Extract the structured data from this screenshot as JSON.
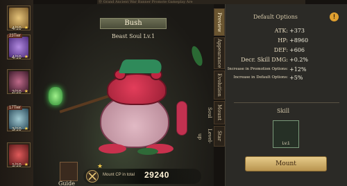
{
  "top_banner": "Ⓓ Grand Ancient War Banner Promote Gameplay Are",
  "roster": [
    {
      "level": "4/10",
      "tier": "",
      "color": "#d8b46a"
    },
    {
      "level": "4/10",
      "tier": "23Tier",
      "color": "#8a5acb"
    },
    {
      "level": "2/10",
      "tier": "",
      "color": "#8a3a5a"
    },
    {
      "level": "3/10",
      "tier": "17Tier",
      "color": "#5a8a9a"
    },
    {
      "level": "1/10",
      "tier": "",
      "color": "#c23a3a"
    }
  ],
  "pet": {
    "name": "Bush",
    "subtitle": "Beast Soul Lv.1"
  },
  "guide_label": "Guide",
  "power": {
    "label": "Mount CP in total",
    "value": "29240"
  },
  "tabs": [
    "Preview",
    "Appearance",
    "Evolution",
    "Mount Soul",
    "Star Level-up"
  ],
  "active_tab": 0,
  "options": {
    "title": "Default Options",
    "info_icon": "!",
    "stats": [
      {
        "key": "ATK:",
        "value": "+373"
      },
      {
        "key": "HP:",
        "value": "+8960"
      },
      {
        "key": "DEF:",
        "value": "+606"
      },
      {
        "key": "Decr. Skill DMG:",
        "value": "+0.2%"
      },
      {
        "key": "Increase in Promotion Options:",
        "value": "+12%"
      },
      {
        "key": "Increase in Default Options:",
        "value": "+5%"
      }
    ]
  },
  "skill": {
    "title": "Skill",
    "level": "Lv.1"
  },
  "mount_button": "Mount"
}
